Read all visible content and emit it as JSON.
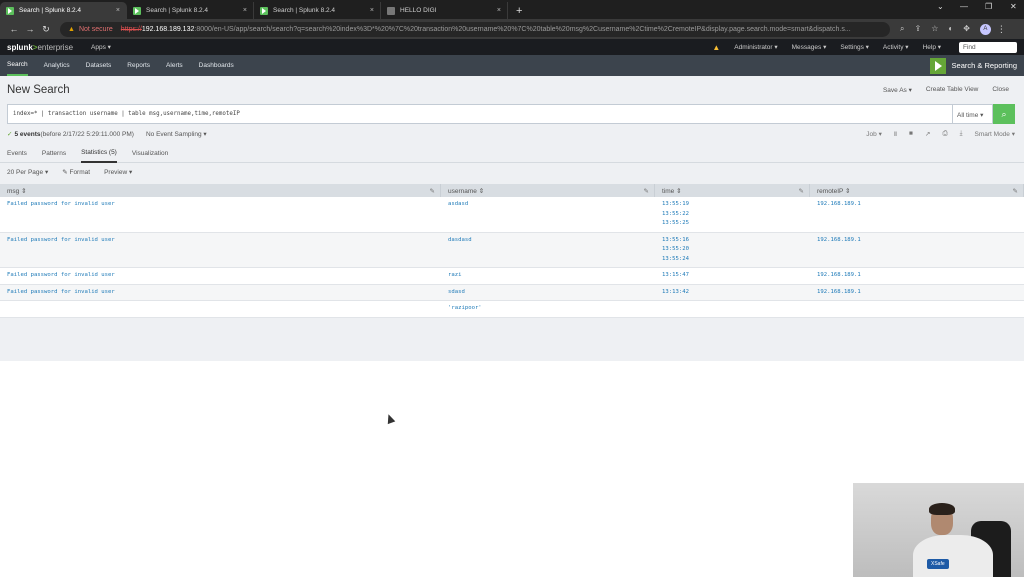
{
  "browser": {
    "tabs": [
      {
        "title": "Search | Splunk 8.2.4",
        "close": "×",
        "active": true
      },
      {
        "title": "Search | Splunk 8.2.4",
        "close": "×",
        "active": false
      },
      {
        "title": "Search | Splunk 8.2.4",
        "close": "×",
        "active": false
      },
      {
        "title": "HELLO DIGI",
        "close": "×",
        "active": false
      }
    ],
    "new_tab": "+",
    "not_secure": "Not secure",
    "url_scheme": "https://",
    "url_host": "192.168.189.132",
    "url_path": ":8000/en-US/app/search/search?q=search%20index%3D*%20%7C%20transaction%20username%20%7C%20table%20msg%2Cusername%2Ctime%2CremoteIP&display.page.search.mode=smart&dispatch.s...",
    "profile_initial": "A"
  },
  "splunk_bar": {
    "logo_splunk": "splunk",
    "logo_gt": ">",
    "logo_enterprise": "enterprise",
    "apps": "Apps ▾",
    "administrator": "Administrator ▾",
    "messages": "Messages ▾",
    "settings": "Settings ▾",
    "activity": "Activity ▾",
    "help": "Help ▾",
    "find": "Find"
  },
  "app_bar": {
    "nav": [
      "Search",
      "Analytics",
      "Datasets",
      "Reports",
      "Alerts",
      "Dashboards"
    ],
    "app_title": "Search & Reporting"
  },
  "page": {
    "title": "New Search",
    "save_as": "Save As ▾",
    "create_table_view": "Create Table View",
    "close": "Close"
  },
  "search": {
    "query": "index=* | transaction username  | table msg,username,time,remoteIP",
    "time_range": "All time ▾"
  },
  "status": {
    "check": "✓",
    "count": "5 events",
    "detail": " (before 2/17/22 5:29:11.000 PM)",
    "sampling": "No Event Sampling ▾",
    "job": "Job ▾",
    "mode": "Smart Mode ▾"
  },
  "result_tabs": [
    "Events",
    "Patterns",
    "Statistics (5)",
    "Visualization"
  ],
  "table_options": {
    "per_page": "20 Per Page ▾",
    "format": "✎ Format",
    "preview": "Preview ▾"
  },
  "table": {
    "columns": [
      "msg ⇕",
      "username ⇕",
      "time ⇕",
      "remoteIP ⇕"
    ],
    "rows": [
      {
        "msg": "Failed password for invalid user",
        "username": "asdasd",
        "time": [
          "13:55:19",
          "13:55:22",
          "13:55:25"
        ],
        "ip": "192.168.189.1"
      },
      {
        "msg": "Failed password for invalid user",
        "username": "dasdasd",
        "time": [
          "13:55:16",
          "13:55:20",
          "13:55:24"
        ],
        "ip": "192.168.189.1"
      },
      {
        "msg": "Failed password for invalid user",
        "username": "razi",
        "time": [
          "13:15:47"
        ],
        "ip": "192.168.189.1"
      },
      {
        "msg": "Failed password for invalid user",
        "username": "sdasd",
        "time": [
          "13:13:42"
        ],
        "ip": "192.168.189.1"
      },
      {
        "msg": "",
        "username": "'razipoor'",
        "time": [],
        "ip": ""
      }
    ]
  },
  "webcam": {
    "badge": "XSafe"
  },
  "colors": {
    "accent": "#5cc05c",
    "link": "#1e7ab8",
    "app_bar": "#3c444d",
    "top_bar": "#1a1c20"
  }
}
